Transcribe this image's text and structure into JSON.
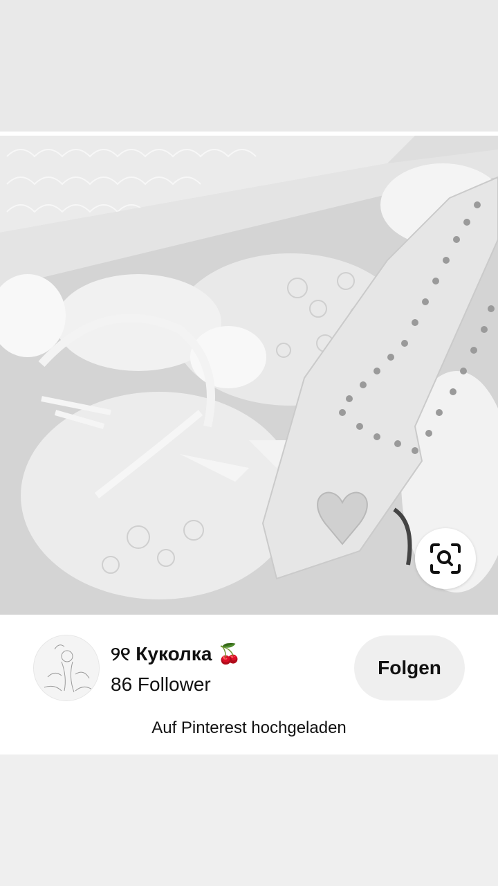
{
  "pin": {
    "image_alt": "",
    "lens_icon": "visual-search-icon"
  },
  "creator": {
    "name": "୨୧ Куколка 🍒",
    "followers": "86 Follower",
    "follow_label": "Folgen"
  },
  "footer": {
    "uploaded_text": "Auf Pinterest hochgeladen"
  },
  "colors": {
    "background": "#efefef",
    "card": "#ffffff",
    "button_bg": "#efefef",
    "text": "#111111"
  }
}
